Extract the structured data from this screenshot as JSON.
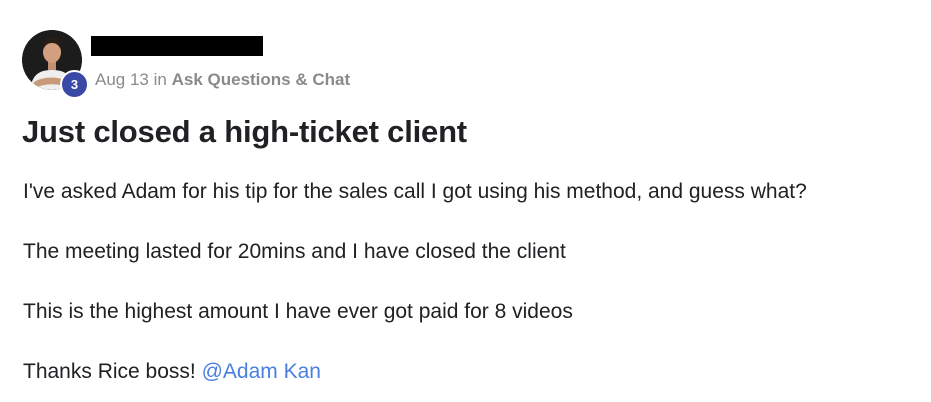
{
  "post": {
    "author": {
      "level": "3",
      "name_redacted": true
    },
    "date": "Aug 13",
    "in_label": "in",
    "category": "Ask Questions & Chat",
    "title": "Just closed a high-ticket client",
    "paragraphs": [
      "I've asked Adam for his tip for the sales call I got using his method, and guess what?",
      "The meeting lasted for 20mins and I have closed the client",
      "This is the highest amount I have ever got paid for 8 videos"
    ],
    "closing_text": "Thanks Rice boss! ",
    "mention": "@Adam Kan"
  },
  "colors": {
    "badge": "#3b49a6",
    "meta_text": "#8a8a8a",
    "mention_link": "#4a7fe0",
    "body_text": "#202124"
  },
  "icons": {
    "avatar": "user-avatar-photo"
  }
}
